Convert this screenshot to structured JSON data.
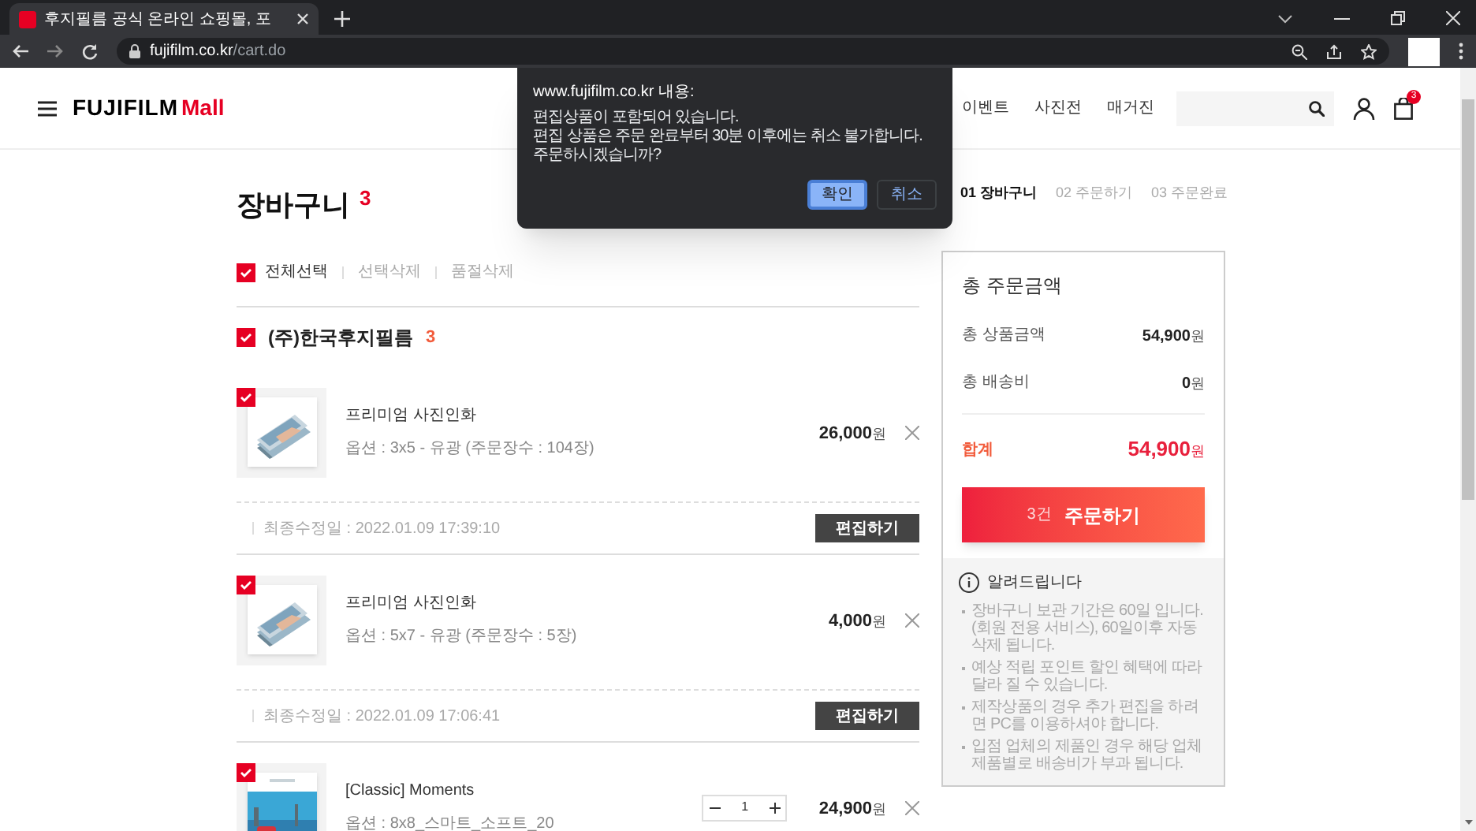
{
  "browser": {
    "tab_title": "후지필름 공식 온라인 쇼핑몰, 포",
    "url_host": "fujifilm.co.kr",
    "url_path": "/cart.do"
  },
  "header": {
    "logo_text": "FUJIFILM",
    "logo_suffix": "Mall",
    "nav": [
      "이벤트",
      "사진전",
      "매거진"
    ],
    "cart_count": "3"
  },
  "dialog": {
    "origin": "www.fujifilm.co.kr 내용:",
    "lines": [
      "편집상품이 포함되어 있습니다.",
      "편집 상품은 주문 완료부터 30분 이후에는 취소 불가합니다.",
      "주문하시겠습니까?"
    ],
    "buttons": [
      {
        "label": "확인",
        "focused": true
      },
      {
        "label": "취소",
        "focused": false
      }
    ]
  },
  "cart": {
    "title": "장바구니",
    "count": "3",
    "steps": [
      {
        "label": "01 장바구니",
        "selected": true
      },
      {
        "label": "02 주문하기",
        "selected": false
      },
      {
        "label": "03 주문완료",
        "selected": false
      }
    ],
    "select_all": {
      "label": "전체선택",
      "checked": true
    },
    "actions": [
      "선택삭제",
      "품절삭제"
    ],
    "seller": {
      "name": "(주)한국후지필름",
      "count": "3",
      "checked": true
    },
    "items": [
      {
        "kind": "print",
        "checked": true,
        "name": "프리미엄 사진인화",
        "option": "옵션 : 3x5 - 유광 (주문장수 : 104장)",
        "price": "26,000",
        "unit": "원",
        "modified": "최종수정일 : 2022.01.09 17:39:10",
        "edit_label": "편집하기"
      },
      {
        "kind": "print",
        "checked": true,
        "name": "프리미엄 사진인화",
        "option": "옵션 : 5x7 - 유광 (주문장수 : 5장)",
        "price": "4,000",
        "unit": "원",
        "modified": "최종수정일 : 2022.01.09 17:06:41",
        "edit_label": "편집하기"
      },
      {
        "kind": "book",
        "checked": true,
        "name": "[Classic] Moments",
        "option": "옵션 : 8x8_스마트_소프트_20",
        "quantity": "1",
        "price": "24,900",
        "unit": "원"
      }
    ]
  },
  "summary": {
    "title": "총 주문금액",
    "rows": [
      {
        "label": "총 상품금액",
        "value": "54,900",
        "unit": "원"
      },
      {
        "label": "총 배송비",
        "value": "0",
        "unit": "원"
      }
    ],
    "total": {
      "label": "합계",
      "value": "54,900",
      "unit": "원"
    },
    "order_button": {
      "count": "3건",
      "label": "주문하기"
    },
    "notice": {
      "title": "알려드립니다",
      "items": [
        "장바구니 보관 기간은 60일 입니다. (회원 전용 서비스), 60일이후 자동 삭제 됩니다.",
        "예상 적립 포인트 할인 혜택에 따라 달라 질 수 있습니다.",
        "제작상품의 경우 추가 편집을 하려면 PC를 이용하셔야 합니다.",
        "입점 업체의 제품인 경우 해당 업체 제품별로 배송비가 부과 됩니다."
      ]
    }
  }
}
